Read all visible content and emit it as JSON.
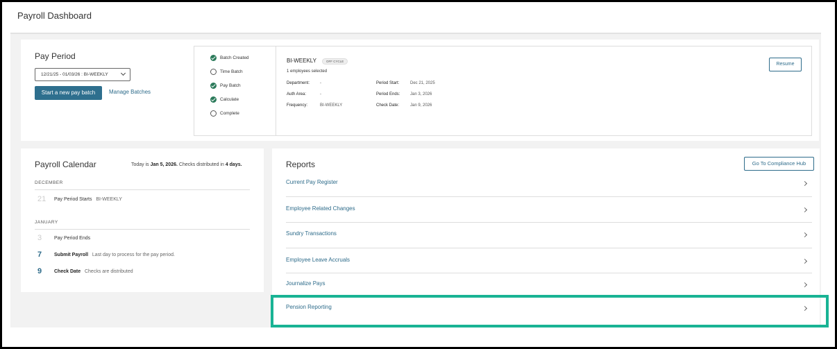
{
  "header": {
    "title": "Payroll Dashboard"
  },
  "pay_period": {
    "title": "Pay Period",
    "selected_period": "12/21/25 - 01/03/26 : BI-WEEKLY",
    "start_button": "Start a new pay batch",
    "manage_link": "Manage Batches"
  },
  "batch": {
    "steps": [
      {
        "label": "Batch Created",
        "done": true
      },
      {
        "label": "Time Batch",
        "done": false
      },
      {
        "label": "Pay Batch",
        "done": true
      },
      {
        "label": "Calculate",
        "done": true
      },
      {
        "label": "Complete",
        "done": false
      }
    ],
    "title": "BI-WEEKLY",
    "badge": "OFF CYCLE",
    "employees_selected": "1 employees selected",
    "fields": {
      "department_label": "Department:",
      "department_value": "-",
      "auth_area_label": "Auth Area:",
      "auth_area_value": "-",
      "frequency_label": "Frequency:",
      "frequency_value": "BI-WEEKLY",
      "period_start_label": "Period Start:",
      "period_start_value": "Dec 21, 2025",
      "period_ends_label": "Period Ends:",
      "period_ends_value": "Jan 3, 2026",
      "check_date_label": "Check Date:",
      "check_date_value": "Jan 9, 2026"
    },
    "resume_button": "Resume"
  },
  "calendar": {
    "title": "Payroll Calendar",
    "today_prefix": "Today is ",
    "today_date": "Jan 5, 2026.",
    "distributed_prefix": " Checks distributed in ",
    "distributed_days": "4 days.",
    "months": [
      {
        "name": "DECEMBER",
        "events": [
          {
            "day": "21",
            "title": "Pay Period Starts",
            "detail": "BI-WEEKLY",
            "past": true
          }
        ]
      },
      {
        "name": "JANUARY",
        "events": [
          {
            "day": "3",
            "title": "Pay Period Ends",
            "detail": "",
            "past": true
          },
          {
            "day": "7",
            "title": "Submit Payroll",
            "detail": "Last day to process for the pay period.",
            "past": false
          },
          {
            "day": "9",
            "title": "Check Date",
            "detail": "Checks are distributed",
            "past": false
          }
        ]
      }
    ]
  },
  "reports": {
    "title": "Reports",
    "hub_button": "Go To Compliance Hub",
    "items": [
      "Current Pay Register",
      "Employee Related Changes",
      "Sundry Transactions",
      "Employee Leave Accruals",
      "Journalize Pays",
      "Pension Reporting"
    ]
  },
  "colors": {
    "accent": "#2d6b8a",
    "primary_button": "#2e6f8e",
    "step_done": "#2b7a5a",
    "highlight": "#19b394"
  }
}
